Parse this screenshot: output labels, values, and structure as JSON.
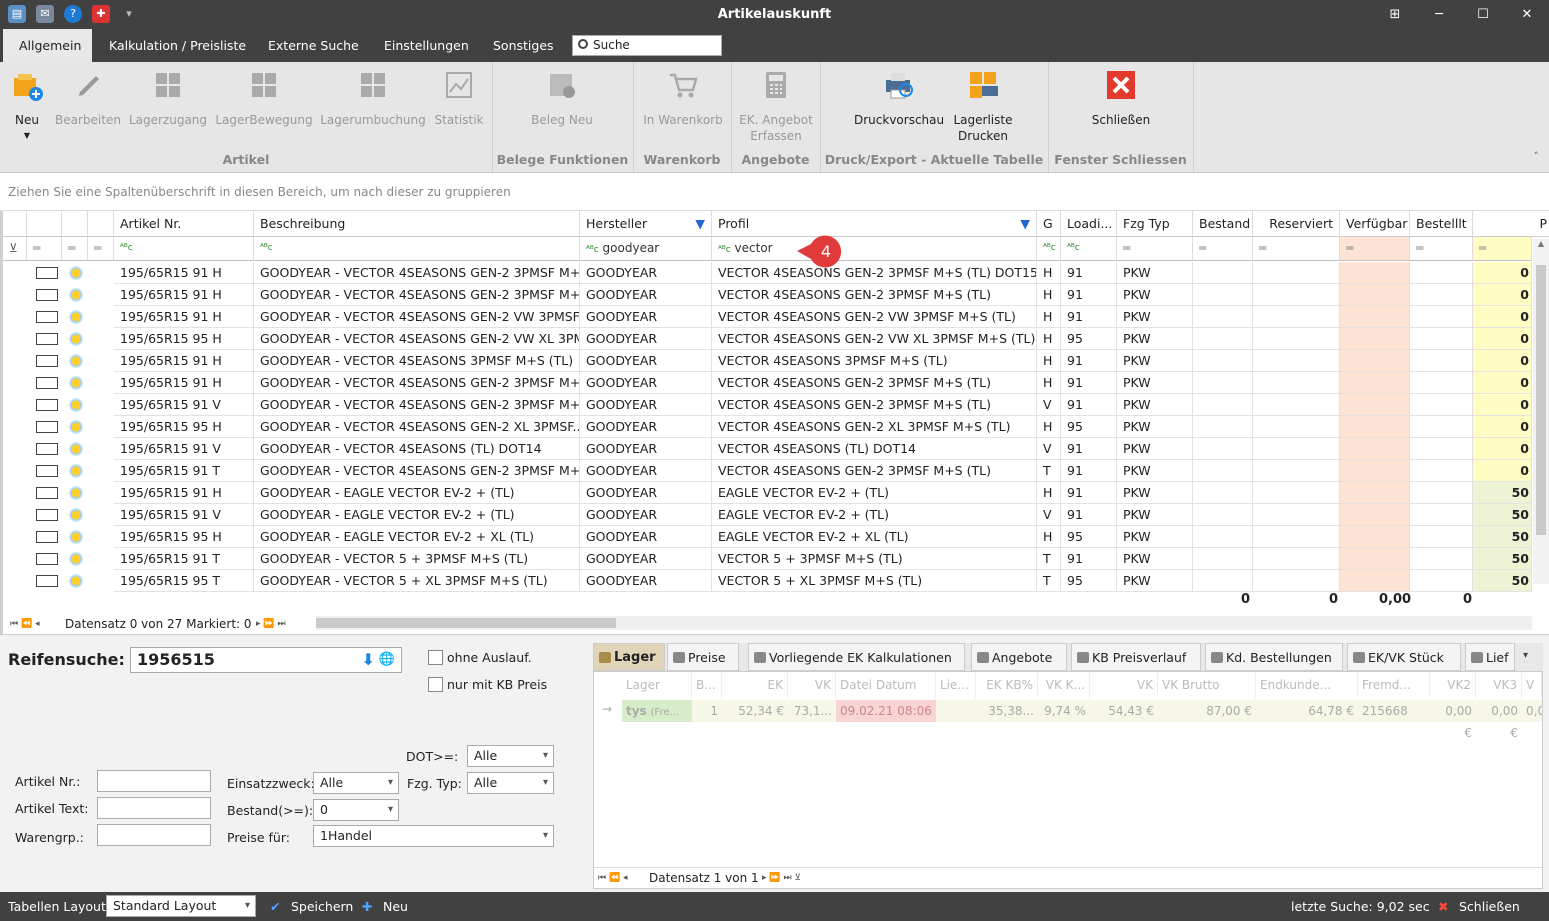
{
  "window": {
    "title": "Artikelauskunft"
  },
  "quick_access": [
    "app-icon",
    "mail-icon",
    "help-icon",
    "flag-icon",
    "dropdown-icon"
  ],
  "window_controls": {
    "restore": "⊞",
    "minimize": "─",
    "maximize": "☐",
    "close": "✕"
  },
  "tabs": [
    "Allgemein",
    "Kalkulation / Preisliste",
    "Externe Suche",
    "Einstellungen",
    "Sonstiges"
  ],
  "search_placeholder": "Suche",
  "ribbon": {
    "new": "Neu",
    "edit": "Bearbeiten",
    "lagerzugang": "Lagerzugang",
    "lagerbewegung": "LagerBewegung",
    "lagerumbuchung": "Lagerumbuchung",
    "statistik": "Statistik",
    "group_artikel": "Artikel",
    "beleg_neu": "Beleg Neu",
    "group_belege": "Belege Funktionen",
    "in_warenkorb": "In Warenkorb",
    "group_warenkorb": "Warenkorb",
    "ek_angebot_1": "EK. Angebot",
    "ek_angebot_2": "Erfassen",
    "group_angebote": "Angebote",
    "druckvorschau": "Druckvorschau",
    "lagerliste_1": "Lagerliste",
    "lagerliste_2": "Drucken",
    "group_druck": "Druck/Export - Aktuelle Tabelle",
    "schliessen": "Schließen",
    "group_fenster": "Fenster Schliessen"
  },
  "group_hint": "Ziehen Sie eine Spaltenüberschrift in diesen Bereich, um nach dieser zu gruppieren",
  "columns": {
    "artikel_nr": "Artikel Nr.",
    "beschreibung": "Beschreibung",
    "hersteller": "Hersteller",
    "profil": "Profil",
    "g": "G",
    "loadi": "Loadi...",
    "fzg_typ": "Fzg Typ",
    "bestand": "Bestand",
    "reserviert": "Reserviert",
    "verfuegbar": "Verfügbar",
    "bestellt": "Bestelllt",
    "p": "P"
  },
  "filters": {
    "abc": "ᴬᴮc",
    "eq": "═",
    "hersteller": "goodyear",
    "profil": "vector"
  },
  "callout_number": "4",
  "rows": [
    {
      "nr": "195/65R15 91 H",
      "desc": "GOODYEAR - VECTOR 4SEASONS GEN-2 3PMSF M+...",
      "hersteller": "GOODYEAR",
      "profil": "VECTOR 4SEASONS GEN-2 3PMSF M+S (TL) DOT15",
      "g": "H",
      "li": "91",
      "typ": "PKW",
      "p": "0"
    },
    {
      "nr": "195/65R15 91 H",
      "desc": "GOODYEAR - VECTOR 4SEASONS GEN-2 3PMSF M+...",
      "hersteller": "GOODYEAR",
      "profil": "VECTOR 4SEASONS GEN-2 3PMSF M+S (TL)",
      "g": "H",
      "li": "91",
      "typ": "PKW",
      "p": "0"
    },
    {
      "nr": "195/65R15 91 H",
      "desc": "GOODYEAR - VECTOR 4SEASONS GEN-2 VW 3PMSF...",
      "hersteller": "GOODYEAR",
      "profil": "VECTOR 4SEASONS GEN-2 VW 3PMSF M+S (TL)",
      "g": "H",
      "li": "91",
      "typ": "PKW",
      "p": "0"
    },
    {
      "nr": "195/65R15 95 H",
      "desc": "GOODYEAR - VECTOR 4SEASONS GEN-2 VW XL 3PM...",
      "hersteller": "GOODYEAR",
      "profil": "VECTOR 4SEASONS GEN-2 VW XL 3PMSF M+S (TL)",
      "g": "H",
      "li": "95",
      "typ": "PKW",
      "p": "0"
    },
    {
      "nr": "195/65R15 91 H",
      "desc": "GOODYEAR - VECTOR 4SEASONS 3PMSF M+S (TL)",
      "hersteller": "GOODYEAR",
      "profil": "VECTOR 4SEASONS 3PMSF M+S (TL)",
      "g": "H",
      "li": "91",
      "typ": "PKW",
      "p": "0"
    },
    {
      "nr": "195/65R15 91 H",
      "desc": "GOODYEAR - VECTOR 4SEASONS GEN-2 3PMSF M+...",
      "hersteller": "GOODYEAR",
      "profil": "VECTOR 4SEASONS GEN-2 3PMSF M+S (TL)",
      "g": "H",
      "li": "91",
      "typ": "PKW",
      "p": "0"
    },
    {
      "nr": "195/65R15 91 V",
      "desc": "GOODYEAR - VECTOR 4SEASONS GEN-2 3PMSF M+...",
      "hersteller": "GOODYEAR",
      "profil": "VECTOR 4SEASONS GEN-2 3PMSF M+S (TL)",
      "g": "V",
      "li": "91",
      "typ": "PKW",
      "p": "0"
    },
    {
      "nr": "195/65R15 95 H",
      "desc": "GOODYEAR - VECTOR 4SEASONS GEN-2 XL 3PMSF...",
      "hersteller": "GOODYEAR",
      "profil": "VECTOR 4SEASONS GEN-2 XL 3PMSF M+S (TL)",
      "g": "H",
      "li": "95",
      "typ": "PKW",
      "p": "0"
    },
    {
      "nr": "195/65R15 91 V",
      "desc": "GOODYEAR - VECTOR 4SEASONS (TL) DOT14",
      "hersteller": "GOODYEAR",
      "profil": "VECTOR 4SEASONS (TL) DOT14",
      "g": "V",
      "li": "91",
      "typ": "PKW",
      "p": "0"
    },
    {
      "nr": "195/65R15 91 T",
      "desc": "GOODYEAR - VECTOR 4SEASONS GEN-2 3PMSF M+...",
      "hersteller": "GOODYEAR",
      "profil": "VECTOR 4SEASONS GEN-2 3PMSF M+S (TL)",
      "g": "T",
      "li": "91",
      "typ": "PKW",
      "p": "0"
    },
    {
      "nr": "195/65R15 91 H",
      "desc": "GOODYEAR - EAGLE VECTOR EV-2 + (TL)",
      "hersteller": "GOODYEAR",
      "profil": "EAGLE VECTOR EV-2 + (TL)",
      "g": "H",
      "li": "91",
      "typ": "PKW",
      "p": "50"
    },
    {
      "nr": "195/65R15 91 V",
      "desc": "GOODYEAR - EAGLE VECTOR EV-2 + (TL)",
      "hersteller": "GOODYEAR",
      "profil": "EAGLE VECTOR EV-2 + (TL)",
      "g": "V",
      "li": "91",
      "typ": "PKW",
      "p": "50"
    },
    {
      "nr": "195/65R15 95 H",
      "desc": "GOODYEAR - EAGLE VECTOR EV-2 + XL (TL)",
      "hersteller": "GOODYEAR",
      "profil": "EAGLE VECTOR EV-2 + XL (TL)",
      "g": "H",
      "li": "95",
      "typ": "PKW",
      "p": "50"
    },
    {
      "nr": "195/65R15 91 T",
      "desc": "GOODYEAR - VECTOR 5 + 3PMSF M+S (TL)",
      "hersteller": "GOODYEAR",
      "profil": "VECTOR 5 + 3PMSF M+S (TL)",
      "g": "T",
      "li": "91",
      "typ": "PKW",
      "p": "50"
    },
    {
      "nr": "195/65R15 95 T",
      "desc": "GOODYEAR - VECTOR 5 + XL 3PMSF M+S (TL)",
      "hersteller": "GOODYEAR",
      "profil": "VECTOR 5 + XL 3PMSF M+S (TL)",
      "g": "T",
      "li": "95",
      "typ": "PKW",
      "p": "50"
    }
  ],
  "totals": {
    "bestand": "0",
    "reserviert": "0",
    "verfuegbar": "0,00",
    "bestellt": "0"
  },
  "nav": {
    "text": "Datensatz 0 von 27 Markiert: 0"
  },
  "reifensuche": {
    "label": "Reifensuche:",
    "value": "1956515"
  },
  "checkboxes": {
    "ohne_auslauf": "ohne Auslauf.",
    "nur_kb": "nur mit KB Preis"
  },
  "form": {
    "dot_label": "DOT>=:",
    "dot_value": "Alle",
    "artikel_nr_label": "Artikel Nr.:",
    "artikel_text_label": "Artikel Text:",
    "warengrp_label": "Warengrp.:",
    "einsatz_label": "Einsatzzweck:",
    "einsatz_value": "Alle",
    "fzg_label": "Fzg. Typ:",
    "fzg_value": "Alle",
    "bestand_label": "Bestand(>=):",
    "bestand_value": "0",
    "preise_label": "Preise für:",
    "preise_value": "1Handel"
  },
  "right_tabs": [
    "Lager",
    "Preise",
    "Vorliegende EK Kalkulationen",
    "Angebote",
    "KB Preisverlauf",
    "Kd. Bestellungen",
    "EK/VK Stück",
    "Lief"
  ],
  "inner_headers": [
    "Lager",
    "B...",
    "EK",
    "VK",
    "Datei Datum",
    "Lie...",
    "EK KB%",
    "VK K...",
    "VK Endk...",
    "VK Brutto",
    "Endkunde...",
    "Fremd...",
    "VK2",
    "VK3",
    "V"
  ],
  "inner_row": {
    "lager": "tys",
    "lager_sub": "(Fre...",
    "b": "1",
    "ek": "52,34 €",
    "vk": "73,1...",
    "datum": "09.02.21 08:06",
    "lie": "",
    "ekkb": "35,38...",
    "vkk": "9,74 %",
    "vkendk": "54,43 €",
    "vkbrutto": "87,00 €",
    "endkunde": "64,78 €",
    "fremd": "215668",
    "vk2": "0,00 €",
    "vk3": "0,00 €",
    "v": "0,0("
  },
  "inner_nav": "Datensatz 1 von 1",
  "status": {
    "layout_label": "Tabellen Layout:",
    "layout_value": "Standard Layout",
    "save": "Speichern",
    "new": "Neu",
    "last_search": "letzte Suche: 9,02 sec",
    "close": "Schließen"
  }
}
